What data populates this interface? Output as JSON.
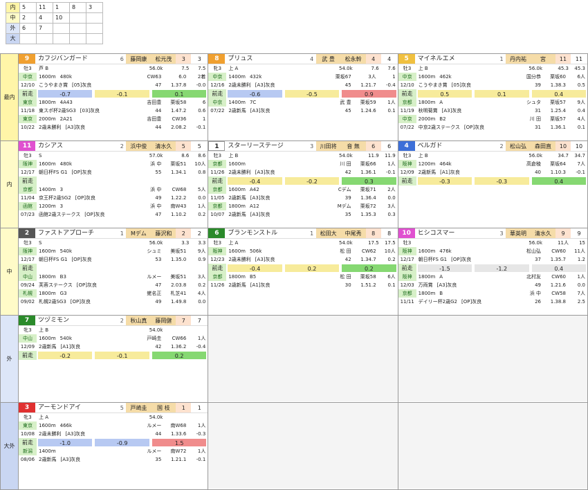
{
  "summary": [
    {
      "label": "内",
      "color": "#fff5a8",
      "vals": [
        "5",
        "11",
        "1",
        "8",
        "3"
      ]
    },
    {
      "label": "中",
      "color": "#fffbc8",
      "vals": [
        "2",
        "4",
        "10",
        "",
        ""
      ]
    },
    {
      "label": "外",
      "color": "#dde6f8",
      "vals": [
        "6",
        "7",
        "",
        "",
        ""
      ]
    },
    {
      "label": "大",
      "color": "#c9d6f2",
      "vals": [
        "",
        "",
        "",
        "",
        ""
      ]
    }
  ],
  "bands": [
    {
      "label": "最内"
    },
    {
      "label": "内"
    },
    {
      "label": "中"
    },
    {
      "label": "外"
    },
    {
      "label": "大外"
    }
  ],
  "rows": [
    [
      {
        "num": "9",
        "numColor": "#f0a030",
        "name": "カフジバンガード",
        "gate": "6",
        "jockey": "藤岡康",
        "trainer": "松元茂",
        "odds1": "3",
        "odds2": "3",
        "sub": [
          "牡3",
          "芦 B",
          "4",
          "2"
        ],
        "weight": "56.0k",
        "trend": "7.5",
        "trend2": "7.5",
        "lines": [
          [
            "中京",
            "1600m",
            "480k",
            "CW63",
            "6.0",
            "2着"
          ],
          [
            "12/10",
            "こうやまき賞",
            "[05]灰良",
            "47",
            "1.37.8",
            "-0.0"
          ]
        ],
        "bars": [
          "-0.7",
          "-0.1",
          "0.1"
        ],
        "barBg": [
          "b-blue",
          "b-yel",
          "b-grn"
        ],
        "foot": "前走",
        "lines2": [
          [
            "東京",
            "1800m",
            "4A43",
            "吉田豊",
            "栗坂58",
            "6"
          ],
          [
            "11/18",
            "東スポ杯2歳SG3",
            "[03]灰良",
            "44",
            "1.47.2",
            "0.6"
          ],
          [
            "東京",
            "2000m",
            "2A21",
            "吉田豊",
            "CW36",
            "1"
          ],
          [
            "10/22",
            "2歳未勝利",
            "[A3]灰良",
            "44",
            "2.08.2",
            "-0.1"
          ]
        ]
      },
      {
        "num": "8",
        "numColor": "#f0a030",
        "name": "プリュス",
        "gate": "4",
        "jockey": "武 豊",
        "trainer": "松永幹",
        "odds1": "4",
        "odds2": "4",
        "sub": [
          "牝3",
          "上 A",
          "",
          "1"
        ],
        "weight": "54.0k",
        "trend": "7.6",
        "trend2": "7.6",
        "lines": [
          [
            "中京",
            "1400m",
            "432k",
            "栗坂67",
            "3人",
            "1"
          ],
          [
            "12/16",
            "2歳未勝利",
            "[A3]灰良",
            "45",
            "1.21.7",
            "-0.4"
          ]
        ],
        "bars": [
          "-0.6",
          "-0.5",
          "0.9"
        ],
        "barBg": [
          "b-blue",
          "b-yel",
          "b-red"
        ],
        "foot": "前走",
        "lines2": [
          [
            "中京",
            "1400m",
            "7C",
            "武 豊",
            "栗坂59",
            "1人"
          ],
          [
            "07/22",
            "2歳新馬",
            "[A3]灰良",
            "45",
            "1.24.6",
            "0.1"
          ],
          [
            "",
            "",
            "",
            "",
            "",
            ""
          ],
          [
            "",
            "",
            "",
            "",
            "",
            ""
          ]
        ]
      },
      {
        "num": "5",
        "numColor": "#f0c040",
        "name": "マイネルエメ",
        "gate": "1",
        "jockey": "丹内祐",
        "trainer": "宮",
        "odds1": "11",
        "odds2": "11",
        "sub": [
          "牡3",
          "上 B",
          "",
          "1"
        ],
        "weight": "56.0k",
        "trend": "45.3",
        "trend2": "45.3",
        "lines": [
          [
            "中京",
            "1600m",
            "462k",
            "国分恭",
            "栗坂60",
            "6人"
          ],
          [
            "12/10",
            "こうやまき賞",
            "[05]灰良",
            "39",
            "1.38.3",
            "0.5"
          ]
        ],
        "bars": [
          "0.5",
          "0.1",
          "0.4"
        ],
        "barBg": [
          "b-yel",
          "b-yel",
          "b-yel"
        ],
        "foot": "前走",
        "lines2": [
          [
            "京都",
            "1800m",
            "A",
            "シュタ",
            "栗坂57",
            "9人"
          ],
          [
            "11/19",
            "秋明菊賞",
            "[A3]灰良",
            "31",
            "1.25.4",
            "0.4"
          ],
          [
            "中京",
            "2000m",
            "B2",
            "川 田",
            "栗坂57",
            "4人"
          ],
          [
            "07/22",
            "中京2歳ステークス",
            "[OP]灰良",
            "31",
            "1.36.1",
            "0.1"
          ]
        ]
      }
    ],
    [
      {
        "num": "11",
        "numColor": "#e050d0",
        "name": "カシアス",
        "gate": "2",
        "jockey": "浜中俊",
        "trainer": "清水久",
        "odds1": "5",
        "odds2": "5",
        "sub": [
          "牡3",
          "S",
          "",
          "3"
        ],
        "weight": "57.0k",
        "trend": "8.6",
        "trend2": "8.6",
        "lines": [
          [
            "阪神",
            "1600m",
            "480k",
            "浜 中",
            "栗坂51",
            "10人"
          ],
          [
            "12/17",
            "朝日杯FS G1",
            "[OP]灰良",
            "55",
            "1.34.1",
            "0.8"
          ]
        ],
        "bars": [
          "",
          "",
          "",
          ""
        ],
        "barBg": [
          "",
          "",
          "",
          ""
        ],
        "foot": "前走",
        "lines2": [
          [
            "京都",
            "1400m",
            "3",
            "浜 中",
            "CW68",
            "5人"
          ],
          [
            "11/04",
            "京王杯2歳SG2",
            "[OP]灰良",
            "49",
            "1.22.2",
            "0.0"
          ],
          [
            "函館",
            "1200m",
            "3",
            "浜 中",
            "南W43",
            "1人"
          ],
          [
            "07/23",
            "函館2歳ステークス",
            "[OP]灰良",
            "47",
            "1.10.2",
            "0.2"
          ]
        ]
      },
      {
        "num": "1",
        "numColor": "#ffffff",
        "name": "スターリーステージ",
        "gate": "3",
        "jockey": "川田将",
        "trainer": "音 無",
        "odds1": "6",
        "odds2": "6",
        "sub": [
          "牡3",
          "上 B",
          "",
          "4"
        ],
        "weight": "54.0k",
        "trend": "11.9",
        "trend2": "11.9",
        "lines": [
          [
            "京都",
            "1600m",
            "",
            "川 田",
            "栗坂66",
            "1人"
          ],
          [
            "11/26",
            "2歳未勝利",
            "[A3]灰良",
            "42",
            "1.36.1",
            "-0.1"
          ]
        ],
        "bars": [
          "-0.4",
          "-0.2",
          "0.3"
        ],
        "barBg": [
          "b-yel",
          "b-yel",
          "b-grn"
        ],
        "foot": "前走",
        "lines2": [
          [
            "京都",
            "1600m",
            "A42",
            "Cデム",
            "栗坂71",
            "2人"
          ],
          [
            "11/05",
            "2歳新馬",
            "[A3]灰良",
            "39",
            "1.36.4",
            "0.0"
          ],
          [
            "京都",
            "1800m",
            "A12",
            "Mデム",
            "栗坂72",
            "3人"
          ],
          [
            "10/07",
            "2歳新馬",
            "[A3]灰良",
            "35",
            "1.35.3",
            "0.3"
          ]
        ]
      },
      {
        "num": "4",
        "numColor": "#3d6fd8",
        "name": "ベルガド",
        "gate": "2",
        "jockey": "松山弘",
        "trainer": "森田直",
        "odds1": "10",
        "odds2": "10",
        "sub": [
          "牡3",
          "上 B",
          "",
          "3"
        ],
        "weight": "56.0k",
        "trend": "34.7",
        "trend2": "34.7",
        "lines": [
          [
            "阪神",
            "1200m",
            "464k",
            "高倉稜",
            "栗坂64",
            "7人"
          ],
          [
            "12/09",
            "2歳新馬",
            "[A1]灰良",
            "40",
            "1.10.3",
            "-0.1"
          ]
        ],
        "bars": [
          "-0.3",
          "-0.3",
          "0.4"
        ],
        "barBg": [
          "b-yel",
          "b-yel",
          "b-grn"
        ],
        "foot": "前走",
        "lines2": [
          [
            "",
            "",
            "",
            "",
            "",
            ""
          ],
          [
            "",
            "",
            "",
            "",
            "",
            ""
          ],
          [
            "",
            "",
            "",
            "",
            "",
            ""
          ],
          [
            "",
            "",
            "",
            "",
            "",
            ""
          ]
        ]
      }
    ],
    [
      {
        "num": "2",
        "numColor": "#555555",
        "name": "ファストアプローチ",
        "gate": "1",
        "jockey": "Mデム",
        "trainer": "藤沢和",
        "odds1": "2",
        "odds2": "2",
        "sub": [
          "牡3",
          "S",
          "",
          "5"
        ],
        "weight": "56.0k",
        "trend": "3.3",
        "trend2": "3.3",
        "lines": [
          [
            "阪神",
            "1600m",
            "540k",
            "シュミ",
            "美坂51",
            "9人"
          ],
          [
            "12/17",
            "朝日杯FS G1",
            "[OP]灰良",
            "53",
            "1.35.0",
            "0.9"
          ]
        ],
        "bars": [
          "",
          "",
          "",
          ""
        ],
        "barBg": [
          "",
          "",
          "",
          ""
        ],
        "foot": "前走",
        "lines2": [
          [
            "中山",
            "1800m",
            "B3",
            "ルメー",
            "美坂51",
            "3人"
          ],
          [
            "09/24",
            "芙蓉ステークス",
            "[OP]灰良",
            "47",
            "2.03.8",
            "0.2"
          ],
          [
            "札幌",
            "1800m",
            "G3",
            "蛯名正",
            "札芝41",
            "4人"
          ],
          [
            "09/02",
            "札幌2歳SG3",
            "[OP]灰良",
            "49",
            "1.49.8",
            "0.0"
          ]
        ]
      },
      {
        "num": "6",
        "numColor": "#2a8a2a",
        "name": "ブランモンストル",
        "gate": "1",
        "jockey": "松田大",
        "trainer": "中尾秀",
        "odds1": "8",
        "odds2": "8",
        "sub": [
          "牡3",
          "上 A",
          "",
          "3"
        ],
        "weight": "54.0k",
        "trend": "17.5",
        "trend2": "17.5",
        "lines": [
          [
            "阪神",
            "1600m",
            "506k",
            "松 田",
            "CW62",
            "10人"
          ],
          [
            "12/23",
            "2歳未勝利",
            "[A3]灰良",
            "42",
            "1.34.7",
            "0.2"
          ]
        ],
        "bars": [
          "-0.4",
          "0.2",
          "0.2"
        ],
        "barBg": [
          "b-yel",
          "b-yel",
          "b-grn"
        ],
        "foot": "前走",
        "lines2": [
          [
            "京都",
            "1800m",
            "B5",
            "松 田",
            "栗坂58",
            "6人"
          ],
          [
            "11/26",
            "2歳新馬",
            "[A1]灰良",
            "30",
            "1.51.2",
            "0.1"
          ],
          [
            "",
            "",
            "",
            "",
            "",
            ""
          ],
          [
            "",
            "",
            "",
            "",
            "",
            ""
          ]
        ]
      },
      {
        "num": "10",
        "numColor": "#e050d0",
        "name": "ヒシコスマー",
        "gate": "3",
        "jockey": "華英明",
        "trainer": "清水久",
        "odds1": "9",
        "odds2": "9",
        "sub": [
          "牡3",
          "",
          "",
          "激"
        ],
        "weight": "56.0k",
        "trend": "11人",
        "trend2": "15",
        "lines": [
          [
            "阪神",
            "1600m",
            "476k",
            "松山弘",
            "CW60",
            "11人"
          ],
          [
            "12/17",
            "朝日杯FS G1",
            "[OP]灰良",
            "37",
            "1.35.7",
            "1.2"
          ]
        ],
        "bars": [
          "-1.5",
          "-1.2",
          "0.4"
        ],
        "barBg": [
          "b-gry",
          "b-gry",
          "b-gry"
        ],
        "foot": "前走",
        "lines2": [
          [
            "阪神",
            "1800m",
            "A",
            "北村友",
            "CW60",
            "1人"
          ],
          [
            "12/03",
            "万両賞",
            "[A3]灰良",
            "49",
            "1.21.6",
            "0.0"
          ],
          [
            "京都",
            "1800m",
            "B",
            "浜 中",
            "CW58",
            "7人"
          ],
          [
            "11/11",
            "デイリー杯2歳G2",
            "[OP]灰良",
            "26",
            "1.38.8",
            "2.5"
          ]
        ]
      }
    ],
    [
      {
        "num": "7",
        "numColor": "#2a8a2a",
        "name": "ツヅミモン",
        "gate": "2",
        "jockey": "秋山真",
        "trainer": "藤岡健",
        "odds1": "7",
        "odds2": "7",
        "sub": [
          "牝3",
          "上 B",
          "",
          "5"
        ],
        "weight": "54.0k",
        "trend": "",
        "trend2": "",
        "lines": [
          [
            "中山",
            "1600m",
            "540k",
            "戸崎圭",
            "CW66",
            "1人"
          ],
          [
            "12/09",
            "2歳新馬",
            "[A1]灰良",
            "42",
            "1.36.2",
            "-0.4"
          ]
        ],
        "bars": [
          "-0.2",
          "-0.1",
          "0.2"
        ],
        "barBg": [
          "b-yel",
          "b-yel",
          "b-grn"
        ],
        "foot": "前走",
        "lines2": [
          [
            "",
            "",
            "",
            "",
            "",
            ""
          ],
          [
            "",
            "",
            "",
            "",
            "",
            ""
          ],
          [
            "",
            "",
            "",
            "",
            "",
            ""
          ],
          [
            "",
            "",
            "",
            "",
            "",
            ""
          ]
        ]
      },
      {
        "empty": true
      },
      {
        "empty": true
      }
    ],
    [
      {
        "num": "3",
        "numColor": "#e03030",
        "name": "アーモンドアイ",
        "gate": "5",
        "jockey": "戸崎圭",
        "trainer": "国 枝",
        "odds1": "1",
        "odds2": "1",
        "sub": [
          "牝3",
          "上 A",
          "",
          "1"
        ],
        "weight": "54.0k",
        "trend": "",
        "trend2": "",
        "lines": [
          [
            "東京",
            "1600m",
            "466k",
            "ルメー",
            "南W68",
            "1人"
          ],
          [
            "10/08",
            "2歳未勝利",
            "[A3]灰良",
            "44",
            "1.33.6",
            "-0.3"
          ]
        ],
        "bars": [
          "-1.0",
          "-0.9",
          "1.5"
        ],
        "barBg": [
          "b-blue",
          "b-blue",
          "b-red"
        ],
        "foot": "前走",
        "lines2": [
          [
            "新潟",
            "1400m",
            "",
            "ルメー",
            "南W72",
            "1人"
          ],
          [
            "08/06",
            "2歳新馬",
            "[A3]灰良",
            "35",
            "1.21.1",
            "-0.1"
          ],
          [
            "",
            "",
            "",
            "",
            "",
            ""
          ],
          [
            "",
            "",
            "",
            "",
            "",
            ""
          ]
        ]
      },
      {
        "empty": true
      },
      {
        "empty": true
      }
    ]
  ]
}
